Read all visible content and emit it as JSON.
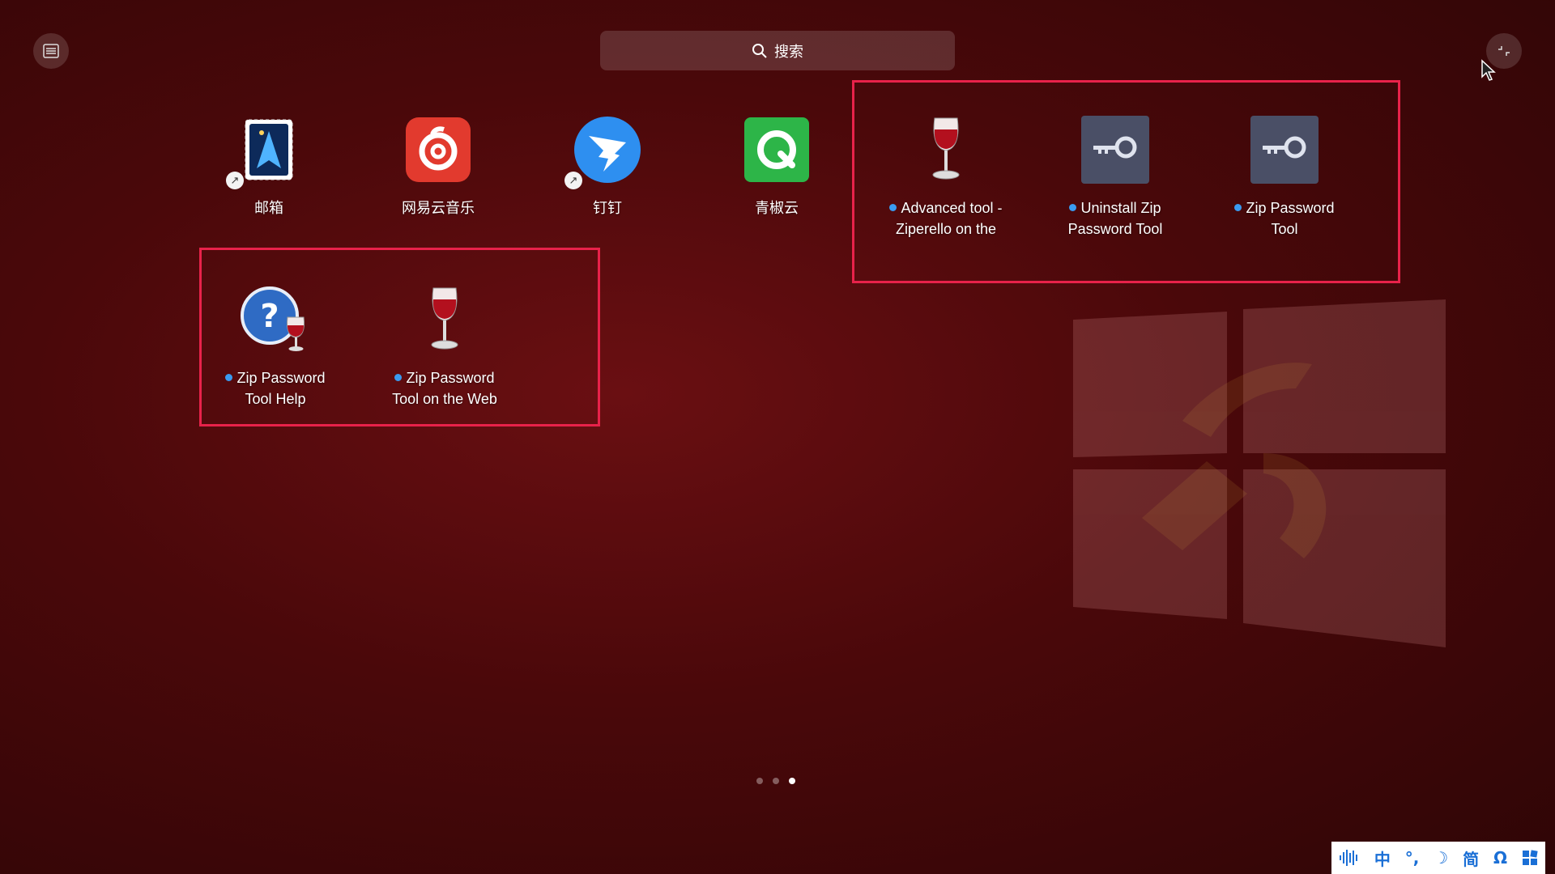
{
  "search": {
    "placeholder": "搜索"
  },
  "apps_row1": [
    {
      "label": "邮箱",
      "icon": "mail-icon",
      "shortcut": true
    },
    {
      "label": "网易云音乐",
      "icon": "netease-music-icon",
      "shortcut": false
    },
    {
      "label": "钉钉",
      "icon": "dingtalk-icon",
      "shortcut": true
    },
    {
      "label": "青椒云",
      "icon": "qingjiao-cloud-icon",
      "shortcut": false
    }
  ],
  "apps_highlight_top": [
    {
      "line1": "Advanced tool -",
      "line2": "Ziperello on the",
      "icon": "wine-glass-icon",
      "new": true
    },
    {
      "line1": "Uninstall Zip",
      "line2": "Password Tool",
      "icon": "key-icon",
      "new": true
    },
    {
      "line1": "Zip Password",
      "line2": "Tool",
      "icon": "key-icon",
      "new": true
    }
  ],
  "apps_highlight_bottom": [
    {
      "line1": "Zip Password",
      "line2": "Tool Help",
      "icon": "help-wine-icon",
      "new": true
    },
    {
      "line1": "Zip Password",
      "line2": "Tool on the Web",
      "icon": "wine-glass-icon",
      "new": true
    }
  ],
  "pager": {
    "pages": 3,
    "current": 3
  },
  "ime": {
    "items": [
      "中",
      "°,",
      "☽",
      "简",
      "Ω"
    ],
    "accent": "#1a6fd6"
  },
  "colors": {
    "highlight": "#e8224a",
    "new_dot": "#3a9bf0"
  }
}
